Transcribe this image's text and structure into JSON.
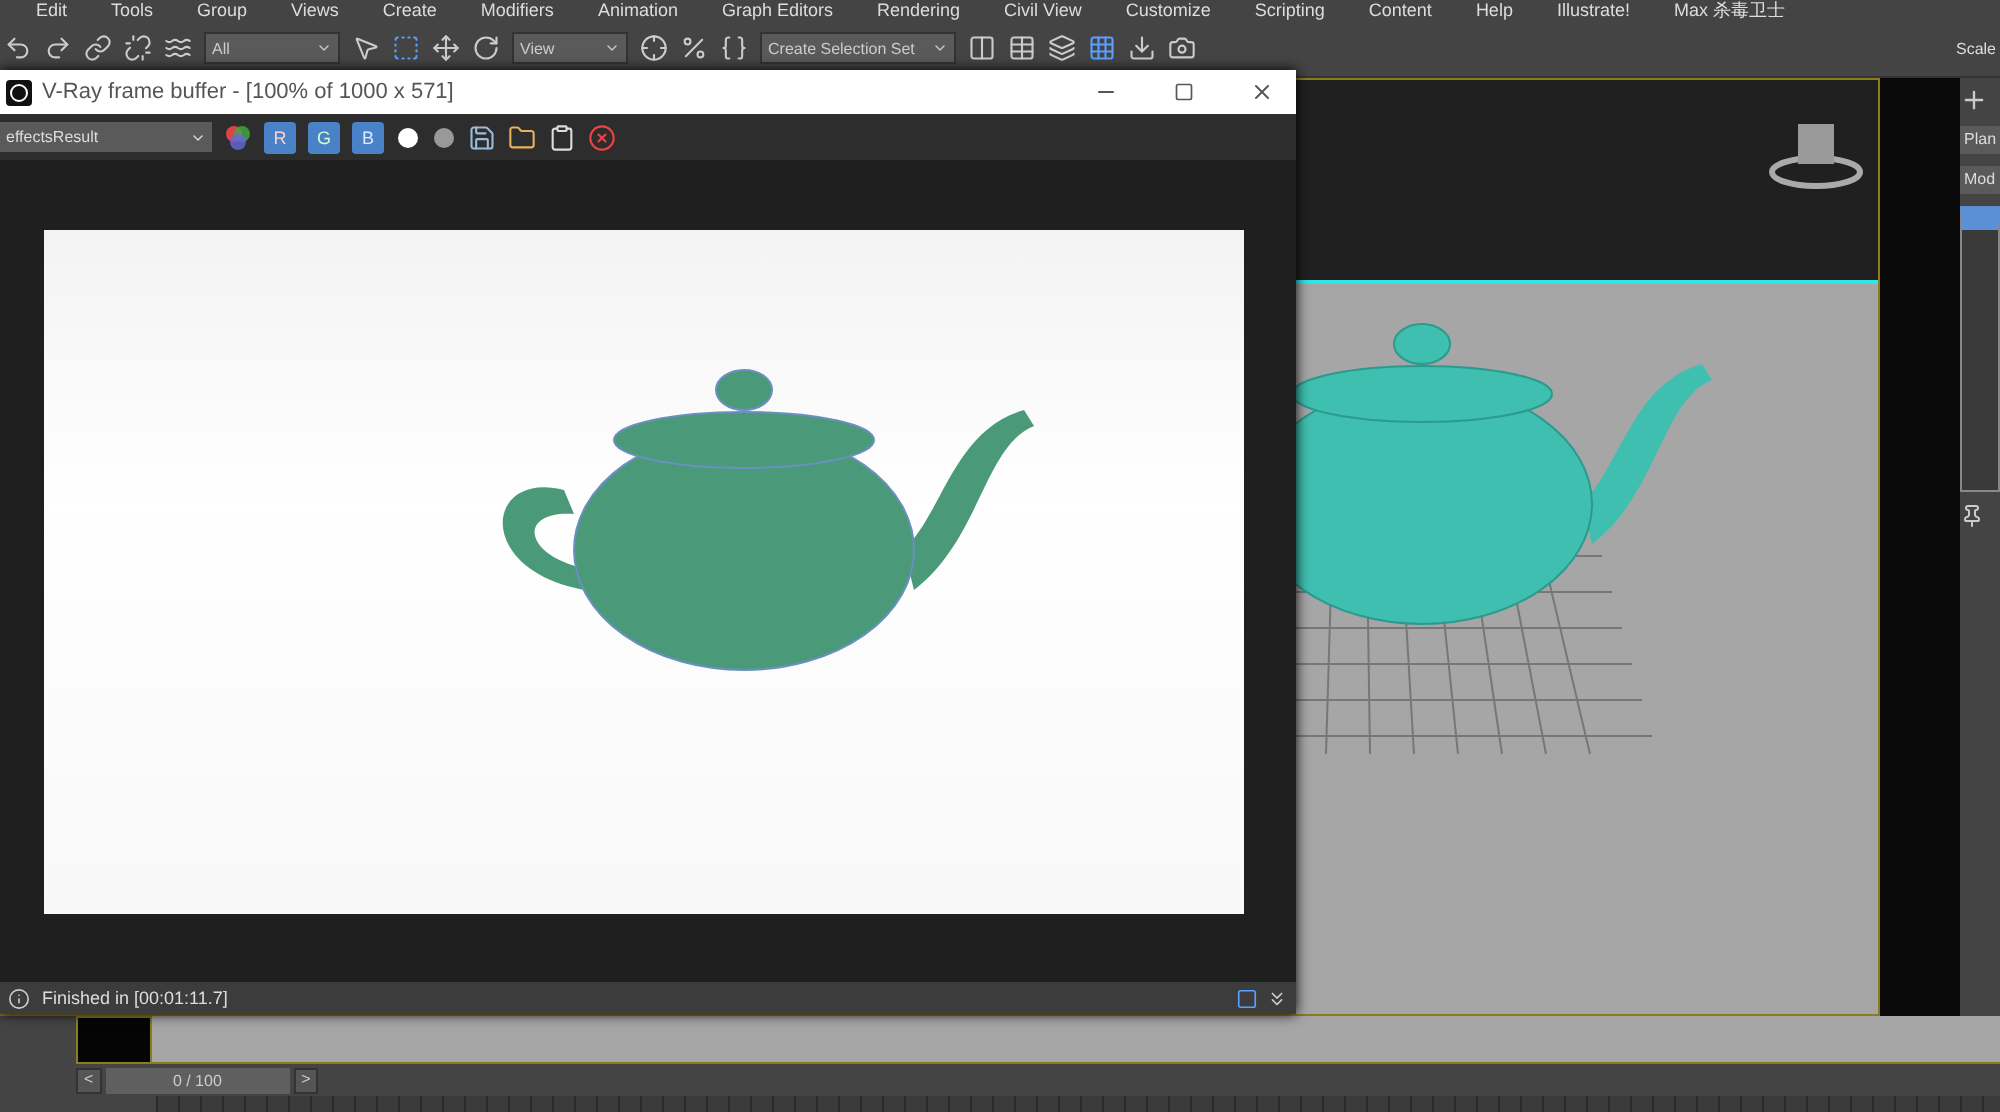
{
  "menu_bar": [
    "Edit",
    "Tools",
    "Group",
    "Views",
    "Create",
    "Modifiers",
    "Animation",
    "Graph Editors",
    "Rendering",
    "Civil View",
    "Customize",
    "Scripting",
    "Content",
    "Help",
    "Illustrate!",
    "Max 杀毒卫士"
  ],
  "toolbar": {
    "selection_filter": "All",
    "reference_coord": "View",
    "selection_set": "Create Selection Set",
    "scale_label": "Scale"
  },
  "frame_buffer": {
    "title": "V-Ray frame buffer - [100% of 1000 x 571]",
    "channel": "effectsResult",
    "channels": [
      {
        "label": "R",
        "selected": true
      },
      {
        "label": "G",
        "selected": true
      },
      {
        "label": "B",
        "selected": true
      }
    ],
    "status": "Finished in [00:01:11.7]"
  },
  "command_panel": {
    "dropdown_1": "Plan",
    "dropdown_2": "Mod"
  },
  "timeline": {
    "frame": "0 / 100",
    "prev": "<",
    "next": ">"
  }
}
